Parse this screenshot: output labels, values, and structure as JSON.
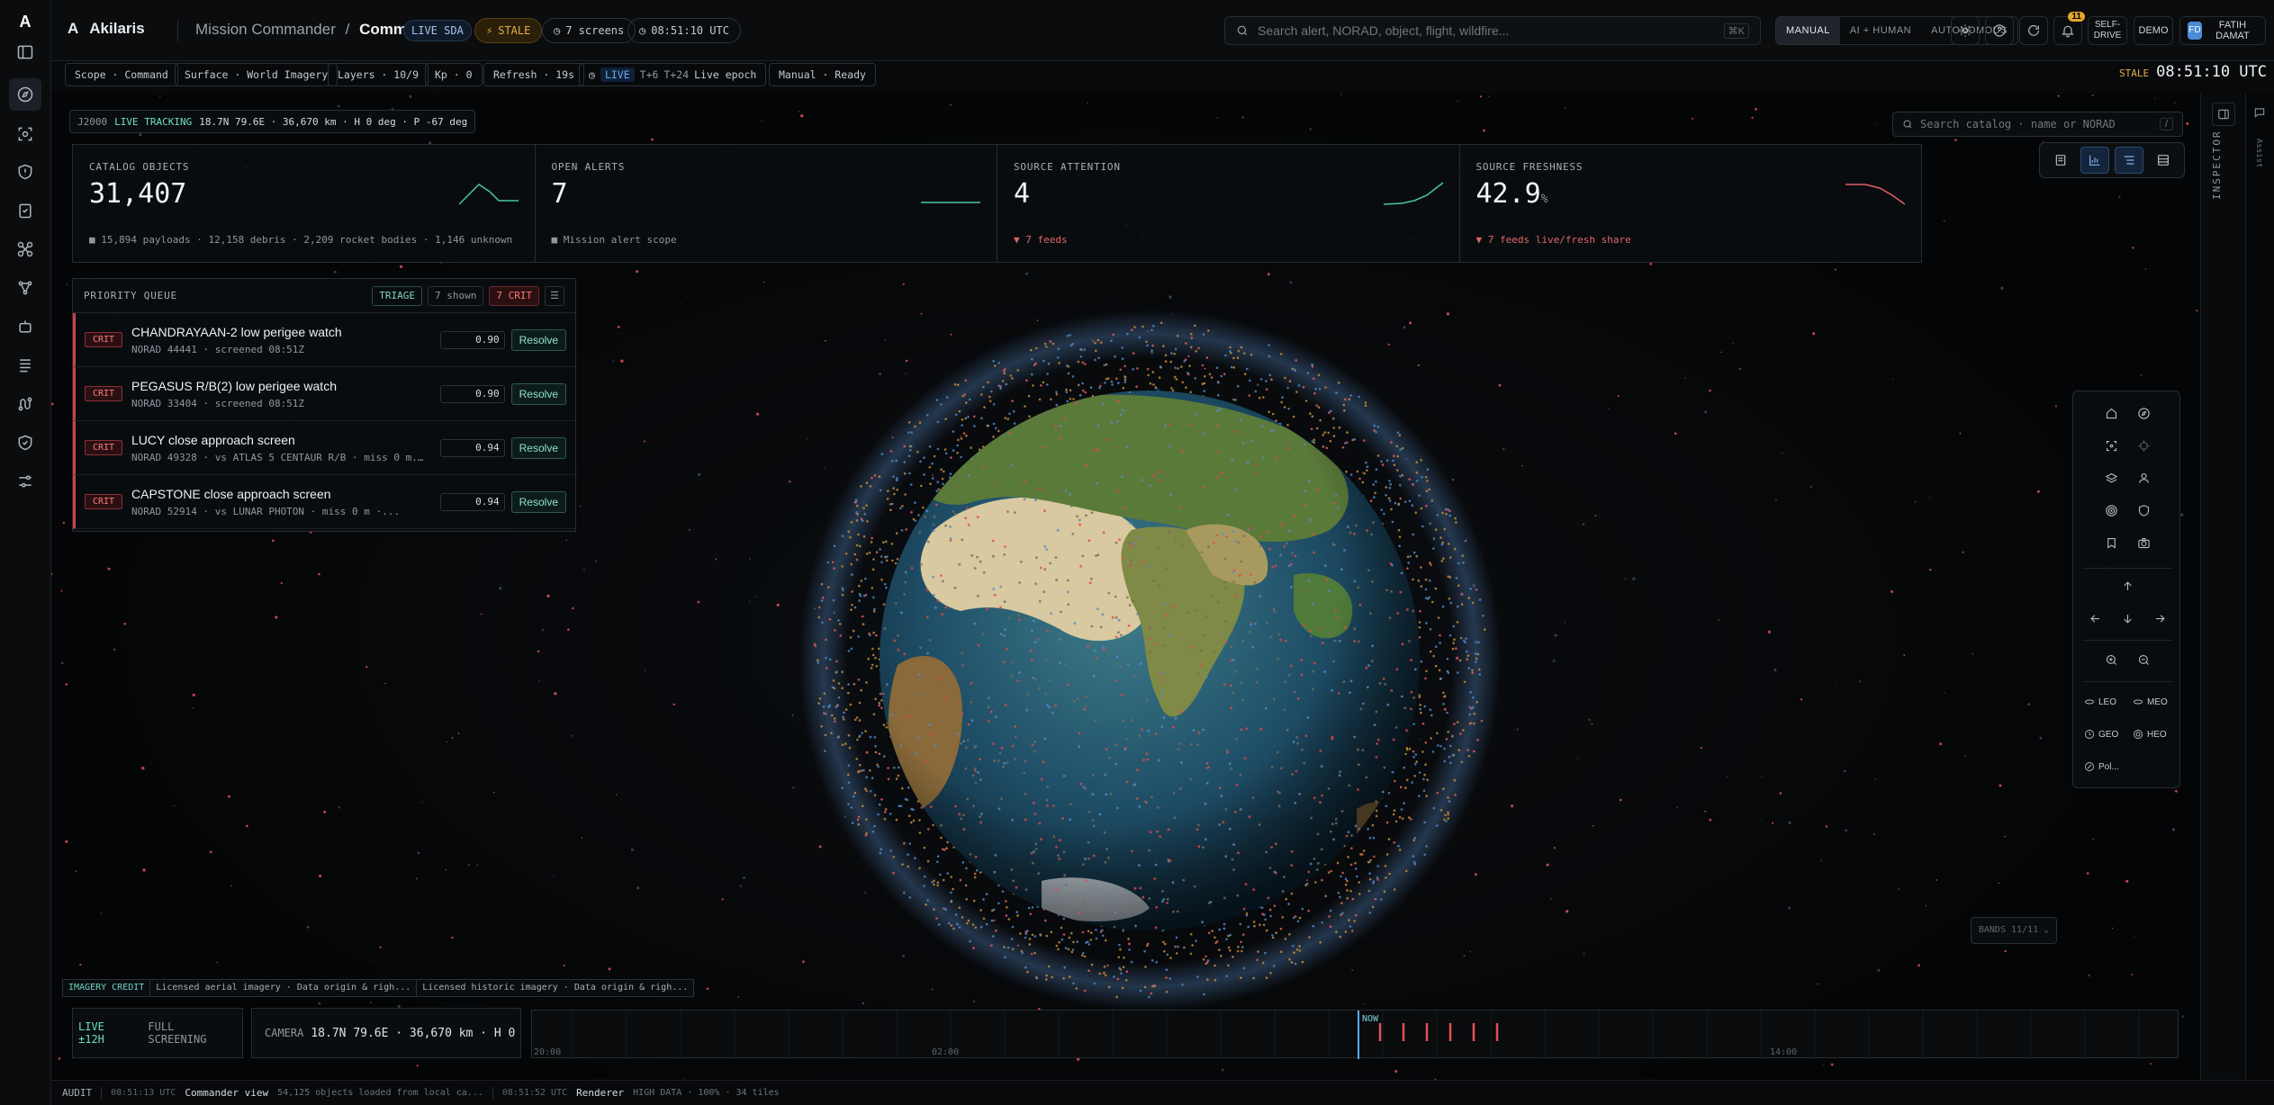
{
  "app": {
    "name": "Akilaris",
    "logo_letter": "A"
  },
  "breadcrumb": {
    "parent": "Mission Commander",
    "sep": "/",
    "current": "Command"
  },
  "status": {
    "live": "LIVE SDA",
    "stale": "STALE",
    "screens": "7 screens",
    "clock": "08:51:10 UTC"
  },
  "search": {
    "placeholder": "Search alert, NORAD, object, flight, wildfire...",
    "shortcut": "⌘K"
  },
  "modes": [
    "MANUAL",
    "AI + HUMAN",
    "AUTONOMOUS"
  ],
  "active_mode": "MANUAL",
  "notifications": {
    "count": "11"
  },
  "self_drive": "SELF-\nDRIVE",
  "demo": "DEMO",
  "user": {
    "initials": "FD",
    "name": "FATIH DAMAT"
  },
  "toolbar": {
    "scope": "Scope · Command",
    "surface": "Surface · World Imagery",
    "layers": "Layers · 10/9",
    "kp": "Kp · 0",
    "refresh": "Refresh · 19s",
    "time_live": "LIVE",
    "time_t6": "T+6",
    "time_t24": "T+24",
    "time_epoch": "Live epoch",
    "mode_status": "Manual · Ready",
    "stale_label": "STALE",
    "stale_time": "08:51:10 UTC"
  },
  "tracking": {
    "frame": "J2000",
    "label": "LIVE TRACKING",
    "detail": "18.7N 79.6E · 36,670 km · H 0 deg · P -67 deg"
  },
  "catalog_search": {
    "placeholder": "Search catalog · name or NORAD",
    "shortcut": "/"
  },
  "kpis": [
    {
      "label": "CATALOG OBJECTS",
      "value": "31,407",
      "unit": "",
      "sub": "■ 15,894 payloads · 12,158 debris · 2,209 rocket bodies · 1,146 unknown",
      "tone": "neutral",
      "spark_color": "#47c7a5"
    },
    {
      "label": "OPEN ALERTS",
      "value": "7",
      "unit": "",
      "sub": "■ Mission alert scope",
      "tone": "neutral",
      "spark_color": "#47c7a5"
    },
    {
      "label": "SOURCE ATTENTION",
      "value": "4",
      "unit": "",
      "sub": "▼ 7 feeds",
      "tone": "red",
      "spark_color": "#47c7a5"
    },
    {
      "label": "SOURCE FRESHNESS",
      "value": "42.9",
      "unit": "%",
      "sub": "▼ 7 feeds live/fresh share",
      "tone": "red",
      "spark_color": "#e0606a"
    }
  ],
  "queue": {
    "title": "PRIORITY QUEUE",
    "triage": "TRIAGE",
    "shown": "7 shown",
    "crit_count": "7 CRIT",
    "items": [
      {
        "severity": "CRIT",
        "name": "CHANDRAYAAN-2 low perigee watch",
        "detail": "NORAD 44441 · screened 08:51Z",
        "score": "0.90",
        "action": "Resolve"
      },
      {
        "severity": "CRIT",
        "name": "PEGASUS R/B(2) low perigee watch",
        "detail": "NORAD 33404 · screened 08:51Z",
        "score": "0.90",
        "action": "Resolve"
      },
      {
        "severity": "CRIT",
        "name": "LUCY close approach screen",
        "detail": "NORAD 49328 · vs ATLAS 5 CENTAUR R/B · miss 0 m...",
        "score": "0.94",
        "action": "Resolve"
      },
      {
        "severity": "CRIT",
        "name": "CAPSTONE close approach screen",
        "detail": "NORAD 52914 · vs LUNAR PHOTON · miss 0 m ·...",
        "score": "0.94",
        "action": "Resolve"
      }
    ]
  },
  "orbit_filters": [
    "LEO",
    "MEO",
    "GEO",
    "HEO",
    "Pol..."
  ],
  "bands": "BANDS 11/11 ⌄",
  "imagery_credit": {
    "label": "IMAGERY CREDIT",
    "a": "Licensed aerial imagery · Data origin & righ...",
    "b": "Licensed historic imagery · Data origin & righ..."
  },
  "timeline": {
    "live_label": "LIVE ±12H",
    "screening": "FULL SCREENING",
    "camera_label": "CAMERA",
    "camera_value": "18.7N 79.6E · 36,670 km · H 0 deg",
    "now": "NOW",
    "ticks": [
      "20:00",
      "02:00",
      "14:00"
    ]
  },
  "inspector": {
    "label": "INSPECTOR",
    "far_label": "Assist"
  },
  "audit": {
    "label": "AUDIT",
    "e1_time": "08:51:13 UTC",
    "e1_name": "Commander view",
    "e1_detail": "54,125 objects loaded from local ca...",
    "e2_time": "08:51:52 UTC",
    "e2_name": "Renderer",
    "e2_detail": "HIGH DATA · 100% · 34 tiles"
  }
}
